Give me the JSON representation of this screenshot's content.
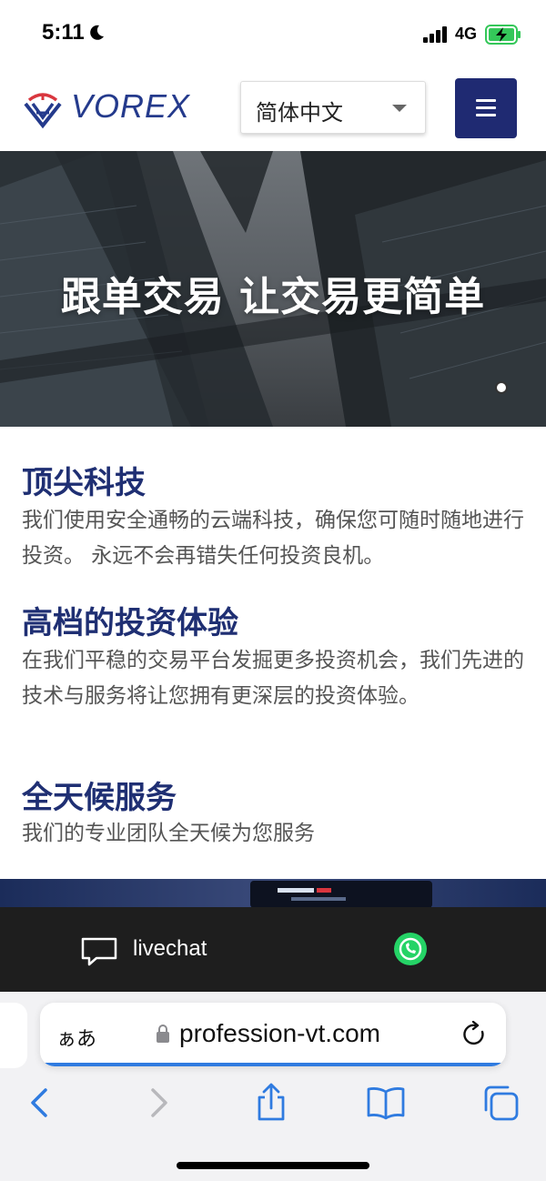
{
  "status_bar": {
    "time": "5:11",
    "network": "4G",
    "icons": [
      "moon-icon",
      "signal-icon",
      "battery-charging-icon"
    ]
  },
  "header": {
    "brand": "VOREX",
    "language": {
      "selected": "简体中文"
    },
    "icons": [
      "vorex-logo",
      "chevron-down-icon",
      "hamburger-menu-icon"
    ]
  },
  "hero": {
    "title": "跟单交易 让交易更简单"
  },
  "features": [
    {
      "title": "顶尖科技",
      "desc": "我们使用安全通畅的云端科技，确保您可随时随地进行投资。 永远不会再错失任何投资良机。"
    },
    {
      "title": "高档的投资体验",
      "desc": "在我们平稳的交易平台发掘更多投资机会，我们先进的技术与服务将让您拥有更深层的投资体验。"
    },
    {
      "title": "全天候服务",
      "desc": "我们的专业团队全天候为您服务"
    }
  ],
  "chat_bar": {
    "livechat_label": "livechat",
    "icons": [
      "chat-bubble-icon",
      "whatsapp-icon"
    ]
  },
  "browser": {
    "text_size": "ぁあ",
    "url": "profession-vt.com",
    "icons": [
      "lock-icon",
      "reload-icon",
      "back-icon",
      "forward-icon",
      "share-icon",
      "bookmarks-icon",
      "tabs-icon"
    ]
  },
  "colors": {
    "brand_navy": "#1f2f73",
    "menu_button": "#1f2a72",
    "logo_red": "#d9363e",
    "whatsapp": "#25d366",
    "progress": "#2f7be0"
  }
}
